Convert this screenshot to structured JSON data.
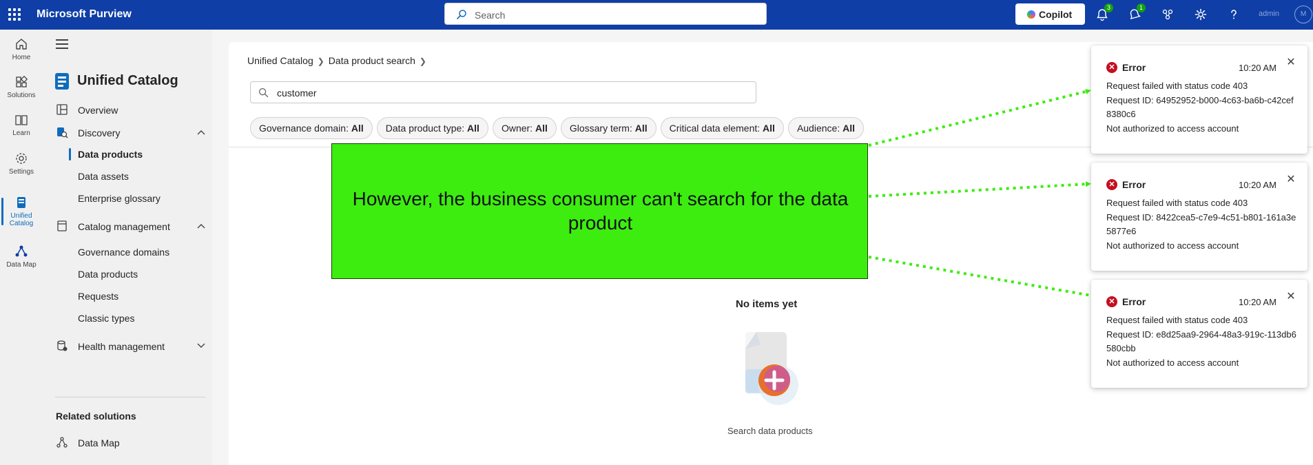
{
  "app": {
    "title": "Microsoft Purview",
    "search_placeholder": "Search",
    "copilot_label": "Copilot",
    "notifications_count": "3",
    "alerts_count": "1",
    "user_label": "admin",
    "avatar_initials": "M"
  },
  "rail": {
    "items": [
      {
        "label": "Home"
      },
      {
        "label": "Solutions"
      },
      {
        "label": "Learn"
      },
      {
        "label": "Settings"
      },
      {
        "label": "Unified Catalog"
      },
      {
        "label": "Data Map"
      }
    ]
  },
  "nav": {
    "title": "Unified Catalog",
    "overview": "Overview",
    "discovery": "Discovery",
    "data_products": "Data products",
    "data_assets": "Data assets",
    "enterprise_glossary": "Enterprise glossary",
    "catalog_management": "Catalog management",
    "governance_domains": "Governance domains",
    "cm_data_products": "Data products",
    "requests": "Requests",
    "classic_types": "Classic types",
    "health_management": "Health management",
    "related_solutions": "Related solutions",
    "data_map": "Data Map"
  },
  "main": {
    "breadcrumb": [
      "Unified Catalog",
      "Data product search"
    ],
    "search_value": "customer",
    "filters": [
      {
        "name": "Governance domain:",
        "value": "All"
      },
      {
        "name": "Data product type:",
        "value": "All"
      },
      {
        "name": "Owner:",
        "value": "All"
      },
      {
        "name": "Glossary term:",
        "value": "All"
      },
      {
        "name": "Critical data element:",
        "value": "All"
      },
      {
        "name": "Audience:",
        "value": "All"
      }
    ],
    "empty_title": "No items yet",
    "empty_caption": "Search data products"
  },
  "annotation": {
    "text": "However, the business consumer can't search for the data product",
    "color": "#3ded0f"
  },
  "toasts": [
    {
      "title": "Error",
      "time": "10:20 AM",
      "line1": "Request failed with status code 403",
      "line2": "Request ID: 64952952-b000-4c63-ba6b-c42cef8380c6",
      "line3": "Not authorized to access account"
    },
    {
      "title": "Error",
      "time": "10:20 AM",
      "line1": "Request failed with status code 403",
      "line2": "Request ID: 8422cea5-c7e9-4c51-b801-161a3e5877e6",
      "line3": "Not authorized to access account"
    },
    {
      "title": "Error",
      "time": "10:20 AM",
      "line1": "Request failed with status code 403",
      "line2": "Request ID: e8d25aa9-2964-48a3-919c-113db6580cbb",
      "line3": "Not authorized to access account"
    }
  ],
  "colors": {
    "topbar": "#0f3ea6",
    "accent": "#0f6cbd",
    "error": "#c50f1f"
  }
}
